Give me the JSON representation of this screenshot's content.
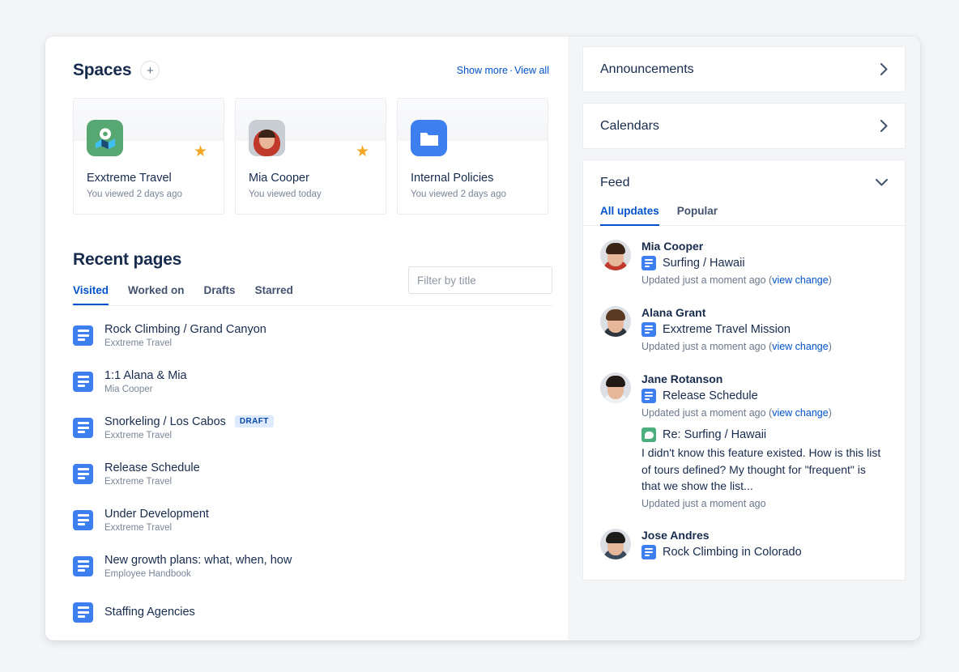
{
  "spaces": {
    "title": "Spaces",
    "add_label": "+",
    "show_more": "Show more",
    "separator": "·",
    "view_all": "View all",
    "cards": [
      {
        "name": "Exxtreme Travel",
        "meta": "You viewed 2 days ago",
        "icon": "map-space-icon",
        "starred": true,
        "star_color": "#f5a623",
        "icon_color": "#57a773"
      },
      {
        "name": "Mia Cooper",
        "meta": "You viewed today",
        "icon": "user-avatar-photo",
        "starred": true,
        "star_color": "#f5a623",
        "icon_color": "#c0392b"
      },
      {
        "name": "Internal Policies",
        "meta": "You viewed 2 days ago",
        "icon": "folder-space-icon",
        "starred": false,
        "icon_color": "#3d7fef"
      }
    ]
  },
  "recent": {
    "title": "Recent pages",
    "tabs": [
      {
        "label": "Visited",
        "active": true
      },
      {
        "label": "Worked on",
        "active": false
      },
      {
        "label": "Drafts",
        "active": false
      },
      {
        "label": "Starred",
        "active": false
      }
    ],
    "filter": {
      "placeholder": "Filter by title",
      "value": ""
    },
    "pages": [
      {
        "title": "Rock Climbing / Grand Canyon",
        "space": "Exxtreme Travel",
        "badge": ""
      },
      {
        "title": "1:1 Alana & Mia",
        "space": "Mia Cooper",
        "badge": ""
      },
      {
        "title": "Snorkeling / Los Cabos",
        "space": "Exxtreme Travel",
        "badge": "DRAFT"
      },
      {
        "title": "Release Schedule",
        "space": "Exxtreme Travel",
        "badge": ""
      },
      {
        "title": "Under Development",
        "space": "Exxtreme Travel",
        "badge": ""
      },
      {
        "title": "New growth plans: what, when, how",
        "space": "Employee Handbook",
        "badge": ""
      },
      {
        "title": "Staffing Agencies",
        "space": "",
        "badge": ""
      }
    ]
  },
  "sidebar": {
    "announcements": {
      "title": "Announcements",
      "state": "collapsed"
    },
    "calendars": {
      "title": "Calendars",
      "state": "collapsed"
    },
    "feed": {
      "title": "Feed",
      "state": "expanded",
      "tabs": [
        {
          "label": "All updates",
          "active": true
        },
        {
          "label": "Popular",
          "active": false
        }
      ],
      "items": [
        {
          "author": "Mia Cooper",
          "entries": [
            {
              "icon": "page-icon",
              "title": "Surfing / Hawaii",
              "meta_prefix": "Updated just a moment ago (",
              "meta_link": "view change",
              "meta_suffix": ")"
            }
          ]
        },
        {
          "author": "Alana Grant",
          "entries": [
            {
              "icon": "page-icon",
              "title": "Exxtreme Travel Mission",
              "meta_prefix": "Updated just a moment ago (",
              "meta_link": "view change",
              "meta_suffix": ")"
            }
          ]
        },
        {
          "author": "Jane Rotanson",
          "entries": [
            {
              "icon": "page-icon",
              "title": "Release Schedule",
              "meta_prefix": "Updated just a moment ago (",
              "meta_link": "view change",
              "meta_suffix": ")"
            },
            {
              "icon": "comment-icon",
              "title": "Re: Surfing / Hawaii",
              "excerpt": "I didn't know this feature existed. How is this list of tours defined? My thought for \"frequent\" is that we show the list...",
              "meta_prefix": "Updated just a moment ago",
              "meta_link": "",
              "meta_suffix": ""
            }
          ]
        },
        {
          "author": "Jose Andres",
          "entries": [
            {
              "icon": "page-icon",
              "title": "Rock Climbing in Colorado",
              "meta_prefix": "",
              "meta_link": "",
              "meta_suffix": ""
            }
          ]
        }
      ]
    }
  },
  "colors": {
    "accent": "#0052cc",
    "text": "#172b4d",
    "muted": "#7a869a",
    "page_bg": "#f4f5f7",
    "doc_blue": "#3d7fef",
    "comment_green": "#4caf7d",
    "star": "#f5a623"
  }
}
